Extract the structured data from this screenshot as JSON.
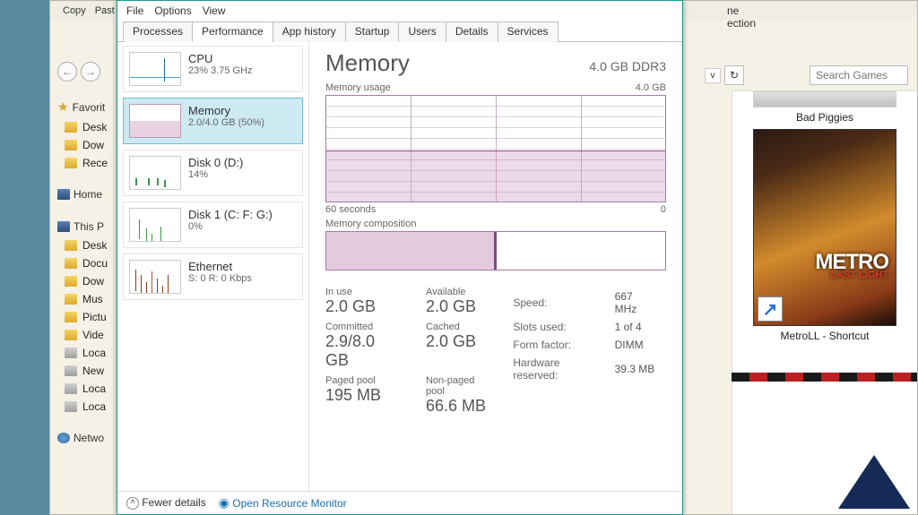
{
  "explorer": {
    "toolbar": {
      "copy": "Copy",
      "paste": "Past"
    },
    "top_right_label": "ection",
    "top_right_extra": "ne",
    "search_placeholder": "Search Games",
    "favorites_header": "Favorit",
    "sidebar": [
      {
        "label": "Desk",
        "icon": "folder"
      },
      {
        "label": "Dow",
        "icon": "folder"
      },
      {
        "label": "Rece",
        "icon": "folder"
      }
    ],
    "homegroup_label": "Home",
    "thispc_label": "This P",
    "thispc_items": [
      {
        "label": "Desk",
        "icon": "folder"
      },
      {
        "label": "Docu",
        "icon": "folder"
      },
      {
        "label": "Dow",
        "icon": "folder"
      },
      {
        "label": "Mus",
        "icon": "folder"
      },
      {
        "label": "Pictu",
        "icon": "folder"
      },
      {
        "label": "Vide",
        "icon": "folder"
      },
      {
        "label": "Loca",
        "icon": "drive"
      },
      {
        "label": "New",
        "icon": "drive"
      },
      {
        "label": "Loca",
        "icon": "drive"
      },
      {
        "label": "Loca",
        "icon": "drive"
      }
    ],
    "network_label": "Netwo",
    "tiles": {
      "bad_piggies": "Bad Piggies",
      "metro_title": "METRO",
      "metro_sub": "LAST LIGHT",
      "metro_label": "MetroLL - Shortcut"
    }
  },
  "taskmgr": {
    "menu": [
      "File",
      "Options",
      "View"
    ],
    "tabs": [
      "Processes",
      "Performance",
      "App history",
      "Startup",
      "Users",
      "Details",
      "Services"
    ],
    "active_tab": 1,
    "side": [
      {
        "title": "CPU",
        "sub": "23% 3.75 GHz",
        "spark": "cpu"
      },
      {
        "title": "Memory",
        "sub": "2.0/4.0 GB (50%)",
        "spark": "mem"
      },
      {
        "title": "Disk 0 (D:)",
        "sub": "14%",
        "spark": "disk"
      },
      {
        "title": "Disk 1 (C: F: G:)",
        "sub": "0%",
        "spark": "disk1"
      },
      {
        "title": "Ethernet",
        "sub": "S: 0 R: 0 Kbps",
        "spark": "eth"
      }
    ],
    "active_side": 1,
    "main": {
      "title": "Memory",
      "spec": "4.0 GB DDR3",
      "usage_label": "Memory usage",
      "usage_max": "4.0 GB",
      "axis_left": "60 seconds",
      "axis_right": "0",
      "comp_label": "Memory composition",
      "stats_left": [
        {
          "label": "In use",
          "value": "2.0 GB"
        },
        {
          "label": "Available",
          "value": "2.0 GB"
        },
        {
          "label": "Committed",
          "value": "2.9/8.0 GB"
        },
        {
          "label": "Cached",
          "value": "2.0 GB"
        },
        {
          "label": "Paged pool",
          "value": "195 MB"
        },
        {
          "label": "Non-paged pool",
          "value": "66.6 MB"
        }
      ],
      "stats_right": [
        {
          "k": "Speed:",
          "v": "667 MHz"
        },
        {
          "k": "Slots used:",
          "v": "1 of 4"
        },
        {
          "k": "Form factor:",
          "v": "DIMM"
        },
        {
          "k": "Hardware reserved:",
          "v": "39.3 MB"
        }
      ]
    },
    "footer": {
      "fewer": "Fewer details",
      "resource": "Open Resource Monitor"
    }
  },
  "chart_data": {
    "type": "line",
    "title": "Memory usage",
    "xlabel": "seconds",
    "ylabel": "GB",
    "xlim": [
      0,
      60
    ],
    "ylim": [
      0,
      4.0
    ],
    "x": [
      60,
      50,
      40,
      30,
      20,
      10,
      0
    ],
    "values": [
      2.0,
      2.0,
      2.0,
      2.0,
      2.0,
      2.0,
      2.0
    ],
    "series_name": "Memory",
    "capacity": "4.0 GB DDR3"
  }
}
